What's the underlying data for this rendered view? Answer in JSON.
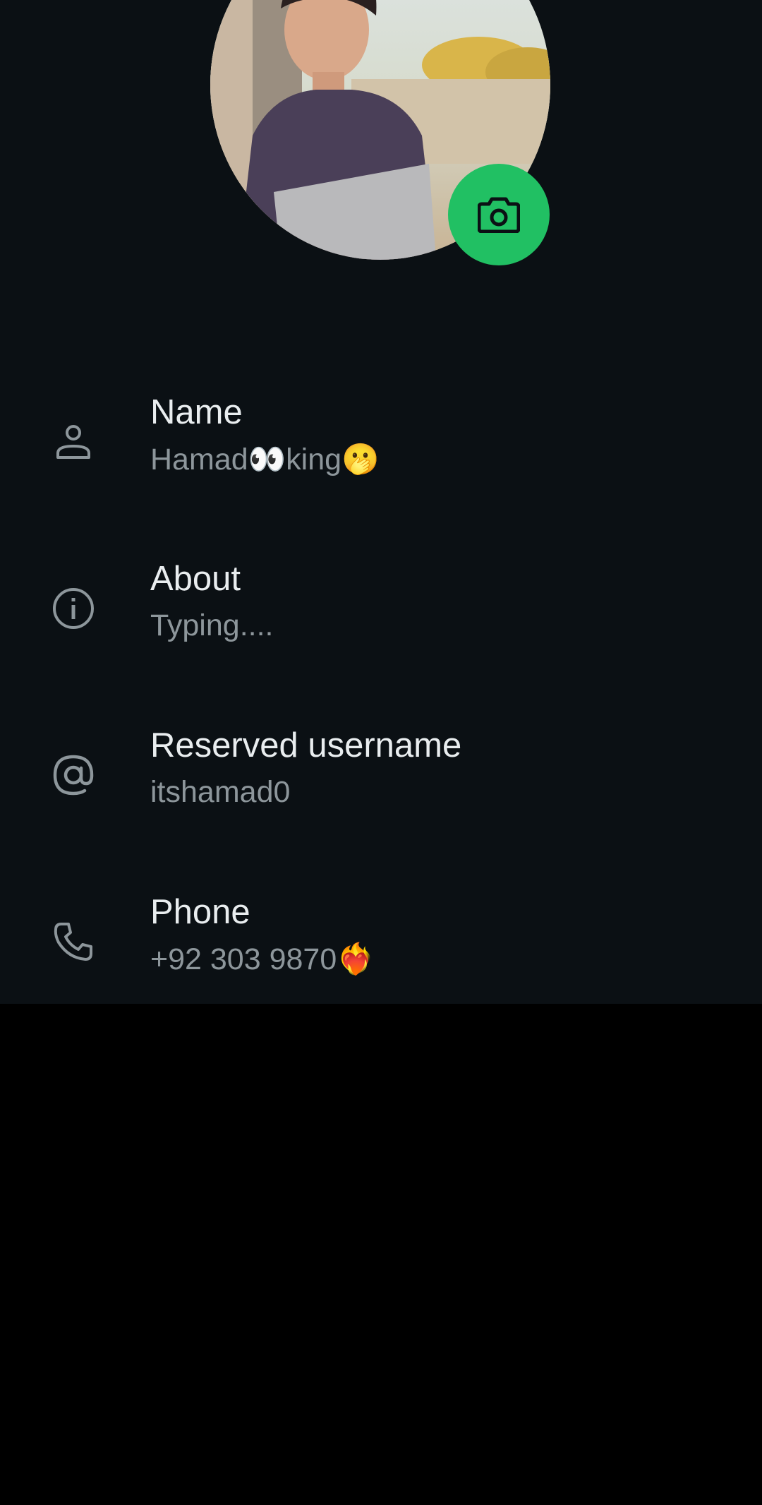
{
  "profile": {
    "colors": {
      "background": "#0b1014",
      "accent": "#21c063",
      "title_text": "#e9edef",
      "value_text": "#8d969b",
      "icon": "#8d969b"
    },
    "camera_button_icon": "camera-icon",
    "fields": [
      {
        "icon": "person-icon",
        "title": "Name",
        "value": "Hamad👀king🫢"
      },
      {
        "icon": "info-icon",
        "title": "About",
        "value": "Typing...."
      },
      {
        "icon": "at-sign-icon",
        "title": "Reserved username",
        "value": "itshamad0"
      },
      {
        "icon": "phone-icon",
        "title": "Phone",
        "value": "+92 303 9870❤️‍🔥"
      }
    ]
  }
}
